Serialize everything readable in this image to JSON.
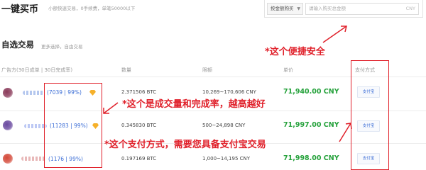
{
  "header": {
    "quick_title": "一键买币",
    "quick_subtitle": "小额快速交易，0手续费，单笔50000以下",
    "mode_select": "按金额购买",
    "amount_placeholder": "请输入购买总金额",
    "amount_unit": "CNY"
  },
  "section": {
    "title": "自选交易",
    "subtitle": "更多选择，自由交易"
  },
  "table": {
    "headers": {
      "merchant": "广告方(30日成单 | 30日完成率)",
      "amount": "数量",
      "limit": "限额",
      "price": "单价",
      "payment": "支付方式"
    },
    "rows": [
      {
        "stats": "(7039 | 99%)",
        "amount": "2.371506 BTC",
        "limit": "10,269~170,606 CNY",
        "price": "71,940.00 CNY",
        "payment": "支付宝",
        "name_color": "#9bb4e8",
        "avatar_color": "#8a3a5a",
        "badge": true
      },
      {
        "stats": "(11283 | 99%)",
        "amount": "0.345830 BTC",
        "limit": "500~24,898 CNY",
        "price": "71,997.00 CNY",
        "payment": "支付宝",
        "name_color": "#a6b6f0",
        "avatar_color": "#6a4aa0",
        "badge": true
      },
      {
        "stats": "(1176 | 99%)",
        "amount": "0.197169 BTC",
        "limit": "1,000~14,195 CNY",
        "price": "71,998.00 CNY",
        "payment": "支付宝",
        "name_color": "#e0a0a0",
        "avatar_color": "#d44a3a",
        "badge": false
      }
    ]
  },
  "annotations": {
    "convenient": "*这个便捷安全",
    "stats": "*这个是成交量和完成率，越高越好",
    "payment": "*这个支付方式，需要您具备支付宝交易"
  },
  "colors": {
    "annotation_red": "#e0202a",
    "price_green": "#26a23c",
    "link_blue": "#3b6dd6"
  }
}
